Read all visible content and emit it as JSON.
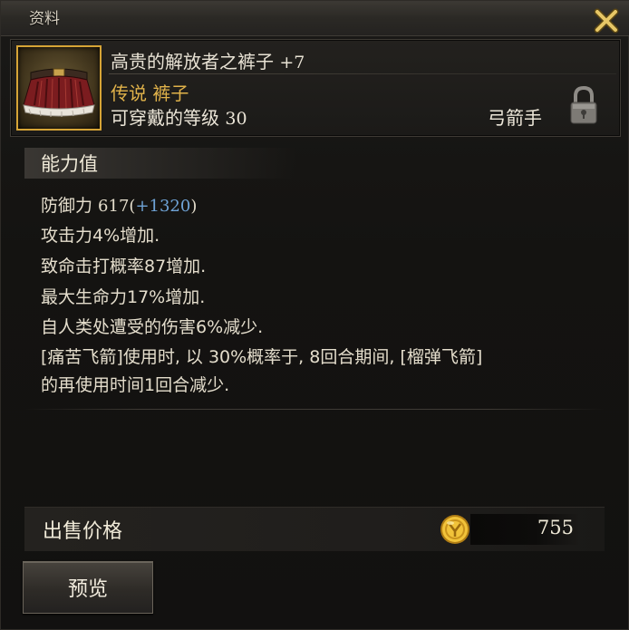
{
  "window": {
    "title": "资料",
    "close_label": "关闭"
  },
  "item": {
    "name": "高贵的解放者之裤子",
    "enhance": "+7",
    "grade_line": "传说 裤子",
    "level_label": "可穿戴的等级 ",
    "level_value": "30",
    "class_restriction": "弓箭手",
    "icon": "leather-skirt-pants-icon",
    "lock_icon": "lock-icon"
  },
  "stats": {
    "title": "能力值",
    "defense_label": "防御力 ",
    "defense_value": "617",
    "defense_bonus": "+1320",
    "lines": [
      "攻击力4%增加.",
      "致命击打概率87增加.",
      "最大生命力17%增加.",
      "自人类处遭受的伤害6%减少.",
      "[痛苦飞箭]使用时, 以 30%概率于, 8回合期间, [榴弹飞箭]",
      "的再使用时间1回合减少."
    ]
  },
  "sell": {
    "label": "出售价格",
    "price": "755",
    "currency_icon": "gold-coin-icon"
  },
  "buttons": {
    "preview": "预览"
  },
  "colors": {
    "grade_gold": "#e0b24a",
    "bonus_blue": "#6fa3d6",
    "frame_gold": "#d6a436"
  }
}
